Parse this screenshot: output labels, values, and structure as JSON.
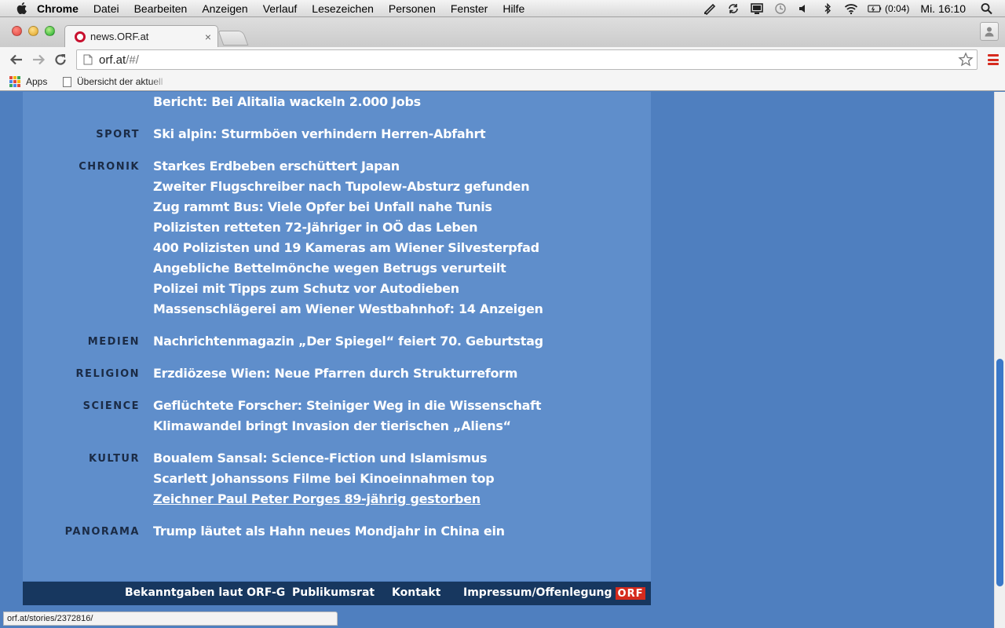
{
  "menubar": {
    "app_name": "Chrome",
    "items": [
      "Datei",
      "Bearbeiten",
      "Anzeigen",
      "Verlauf",
      "Lesezeichen",
      "Personen",
      "Fenster",
      "Hilfe"
    ],
    "battery_time": "(0:04)",
    "clock": "Mi. 16:10"
  },
  "browser": {
    "tab_title": "news.ORF.at",
    "tab_close": "×",
    "url_host": "orf.at",
    "url_path": "/#/",
    "bookmarks": {
      "apps": "Apps",
      "item1": "Übersicht der aktuell"
    },
    "status_url": "orf.at/stories/2372816/"
  },
  "content": {
    "top_headline": "Bericht: Bei Alitalia wackeln 2.000 Jobs",
    "sections": [
      {
        "category": "SPORT",
        "headlines": [
          "Ski alpin: Sturmböen verhindern Herren-Abfahrt"
        ]
      },
      {
        "category": "CHRONIK",
        "headlines": [
          "Starkes Erdbeben erschüttert Japan",
          "Zweiter Flugschreiber nach Tupolew-Absturz gefunden",
          "Zug rammt Bus: Viele Opfer bei Unfall nahe Tunis",
          "Polizisten retteten 72-Jähriger in OÖ das Leben",
          "400 Polizisten und 19 Kameras am Wiener Silvesterpfad",
          "Angebliche Bettelmönche wegen Betrugs verurteilt",
          "Polizei mit Tipps zum Schutz vor Autodieben",
          "Massenschlägerei am Wiener Westbahnhof: 14 Anzeigen"
        ]
      },
      {
        "category": "MEDIEN",
        "headlines": [
          "Nachrichtenmagazin „Der Spiegel“ feiert 70. Geburtstag"
        ]
      },
      {
        "category": "RELIGION",
        "headlines": [
          "Erzdiözese Wien: Neue Pfarren durch Strukturreform"
        ]
      },
      {
        "category": "SCIENCE",
        "headlines": [
          "Geflüchtete Forscher: Steiniger Weg in die Wissenschaft",
          "Klimawandel bringt Invasion der tierischen „Aliens“"
        ]
      },
      {
        "category": "KULTUR",
        "headlines": [
          "Boualem Sansal: Science-Fiction und Islamismus",
          "Scarlett Johanssons Filme bei Kinoeinnahmen top",
          "Zeichner Paul Peter Porges 89-jährig gestorben"
        ]
      },
      {
        "category": "PANORAMA",
        "headlines": [
          "Trump läutet als Hahn neues Mondjahr in China ein"
        ]
      }
    ]
  },
  "footer": {
    "links": [
      "Bekanntgaben laut ORF-G",
      "Publikumsrat",
      "Kontakt",
      "Impressum/Offenlegung"
    ],
    "logo": "ORF"
  },
  "colors": {
    "page_bg": "#4f7fbf",
    "panel_bg": "#5f8ecb",
    "footer_bg": "#17375f",
    "brand_red": "#d52b1e"
  }
}
